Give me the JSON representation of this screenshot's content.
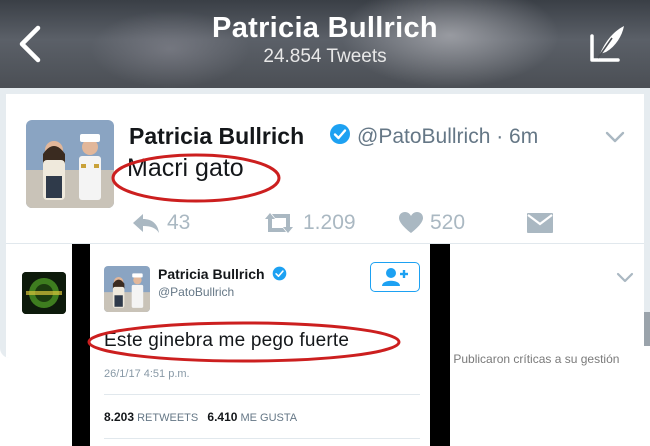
{
  "profile_header": {
    "name": "Patricia Bullrich",
    "tweet_count": "24.854 Tweets"
  },
  "tweet_main": {
    "display_name": "Patricia Bullrich",
    "handle_time": "@PatoBullrich · 6m",
    "text": "Macri gato",
    "reply_count": "43",
    "retweet_count": "1.209",
    "like_count": "520"
  },
  "background_snippet": "o. Publicaron críticas a su gestión",
  "tweet_overlay": {
    "display_name": "Patricia Bullrich",
    "handle": "@PatoBullrich",
    "text": "Este ginebra me pego fuerte",
    "date": "26/1/17 4:51 p.m.",
    "retweets_value": "8.203",
    "retweets_label": "RETWEETS",
    "likes_value": "6.410",
    "likes_label": "ME GUSTA"
  },
  "colors": {
    "twitter_blue": "#1da1f2",
    "highlight_red": "#cc1f1f",
    "icon_gray": "#aab8c2"
  },
  "icons": [
    "back-arrow-icon",
    "compose-icon",
    "verified-badge-icon",
    "chevron-down-icon",
    "reply-icon",
    "retweet-icon",
    "like-heart-icon",
    "direct-message-icon",
    "follow-user-icon"
  ]
}
